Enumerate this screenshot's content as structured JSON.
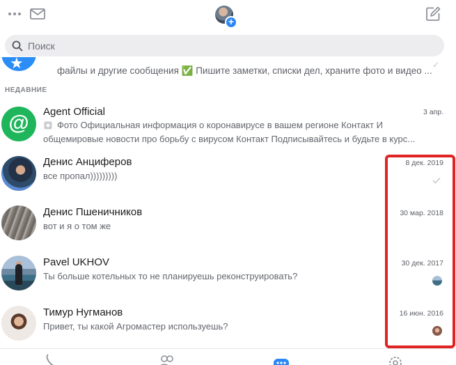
{
  "header": {
    "more_icon": "more-dots-icon",
    "mail_icon": "mail-icon",
    "add_icon": "plus-icon",
    "compose_icon": "compose-icon"
  },
  "search": {
    "placeholder": "Поиск"
  },
  "pinned": {
    "text": "файлы и другие сообщения ✅ Пишите заметки, списки дел, храните фото и видео ..."
  },
  "section": {
    "label": "НЕДАВНИЕ"
  },
  "chats": [
    {
      "name": "Agent Official",
      "date": "3 апр.",
      "preview_line1": "Фото Официальная информация о коронавирусе в вашем регионе Контакт И",
      "preview_line2": "общемировые новости про борьбу с вирусом Контакт Подписывайтесь и будьте в курс..."
    },
    {
      "name": "Денис Анциферов",
      "date": "8 дек. 2019",
      "preview": "все пропал)))))))))"
    },
    {
      "name": "Денис Пшеничников",
      "date": "30 мар. 2018",
      "preview": "вот и я о том же"
    },
    {
      "name": "Pavel UKHOV",
      "date": "30 дек. 2017",
      "preview": "Ты больше котельных то не планируешь реконструировать?"
    },
    {
      "name": "Тимур Нугманов",
      "date": "16 июн. 2016",
      "preview": "Привет, ты какой Агромастер используешь?"
    }
  ],
  "colors": {
    "accent": "#2b87f5",
    "highlight": "#e02424",
    "agent_green": "#1fb65b"
  },
  "bottom_nav": [
    "phone-icon",
    "contacts-icon",
    "chats-icon",
    "settings-icon"
  ]
}
